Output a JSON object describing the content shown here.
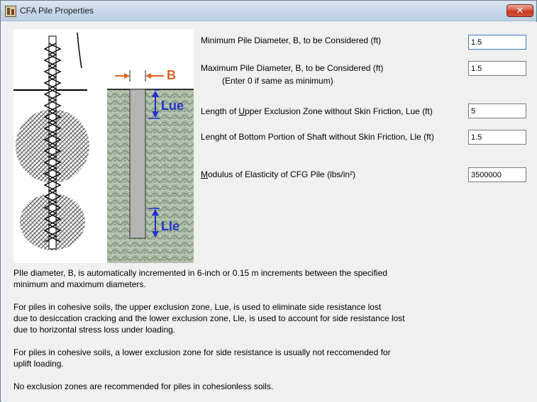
{
  "window": {
    "title": "CFA Pile Properties",
    "close_glyph": "✕"
  },
  "diagram": {
    "label_b": "B",
    "label_lue": "Lue",
    "label_lle": "Lle",
    "colors": {
      "b_label": "#e06420",
      "zone_labels": "#2233cc",
      "soil": "#8fa28a",
      "pile": "#b4b4b4"
    }
  },
  "form": {
    "min_diameter": {
      "label": "Minimum Pile Diameter, B, to be Considered (ft)",
      "value": "1.5"
    },
    "max_diameter": {
      "label": "Maximum Pile Diameter, B, to be Considered (ft)",
      "sublabel": "(Enter 0 if same as minimum)",
      "value": "1.5"
    },
    "upper_exclusion": {
      "label_before": "Length of ",
      "label_underline": "U",
      "label_after": "pper Exclusion Zone without Skin Friction, Lue (ft)",
      "value": "5"
    },
    "bottom_portion": {
      "label": "Lenght of Bottom Portion of Shaft without Skin Friction, Lle (ft)",
      "value": "1.5"
    },
    "modulus": {
      "label_underline": "M",
      "label_after": "odulus of Elasticity of CFG Pile (lbs/in²)",
      "value": "3500000"
    }
  },
  "notes": {
    "p1_line1": "PIle diameter, B, is automatically incremented in 6-inch or 0.15 m increments between the specified",
    "p1_line2": "minimum and maximum diameters.",
    "p2_line1": "For piles in cohesive soils, the upper exclusion zone, Lue, is used to eliminate side resistance lost",
    "p2_line2": "due to desiccation cracking and the lower exclusion zone, Lle, is used to account for side resistance lost",
    "p2_line3": "due to horizontal stress loss under loading.",
    "p3_line1": "For piles in cohesive soils, a lower exclusion zone for side resistance is usually not reccomended for",
    "p3_line2": "uplift loading.",
    "p4_line1": "No exclusion zones are recommended for piles in cohesionless soils."
  }
}
